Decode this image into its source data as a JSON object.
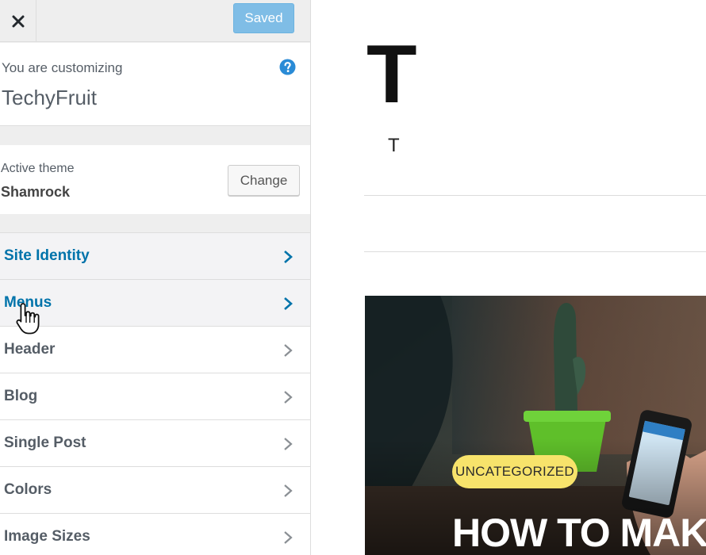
{
  "topbar": {
    "close_icon": "close-icon",
    "saved_label": "Saved"
  },
  "info": {
    "pre_title": "You are customizing",
    "site_title": "TechyFruit",
    "help_icon": "help-icon"
  },
  "theme": {
    "pre_title": "Active theme",
    "name": "Shamrock",
    "change_label": "Change"
  },
  "sections": [
    {
      "label": "Site Identity",
      "highlighted": true
    },
    {
      "label": "Menus",
      "highlighted": true
    },
    {
      "label": "Header",
      "highlighted": false
    },
    {
      "label": "Blog",
      "highlighted": false
    },
    {
      "label": "Single Post",
      "highlighted": false
    },
    {
      "label": "Colors",
      "highlighted": false
    },
    {
      "label": "Image Sizes",
      "highlighted": false
    }
  ],
  "preview": {
    "brand_letter": "T",
    "tagline_letter": "T",
    "post_category": "UNCATEGORIZED",
    "post_title": "HOW TO MAKE A"
  },
  "colors": {
    "accent_link": "#0073aa",
    "saved_button": "#7fbde6",
    "category_badge": "#f7e36b"
  }
}
